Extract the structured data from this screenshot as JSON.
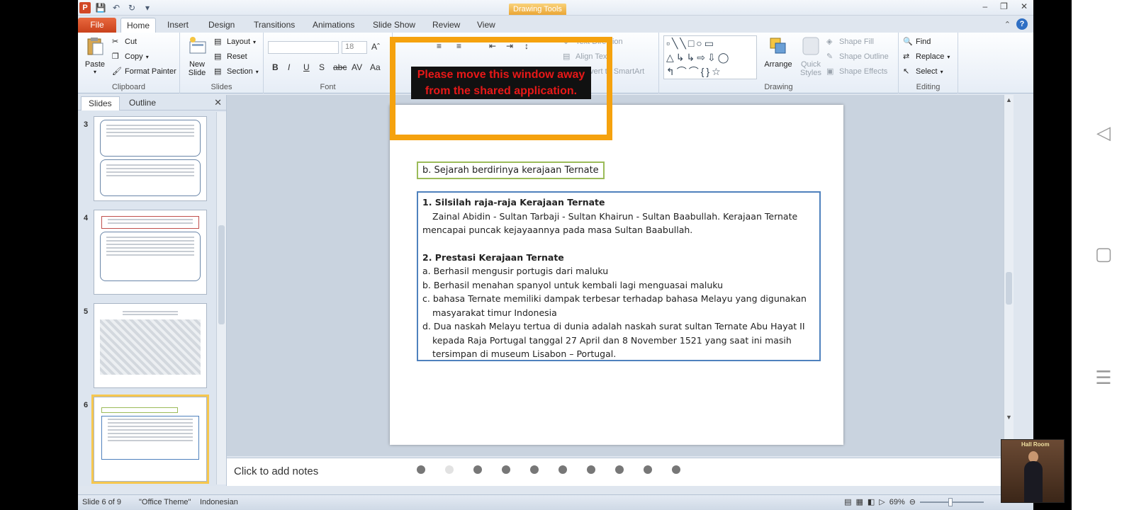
{
  "window": {
    "contextual_tab": "Drawing Tools",
    "controls": [
      "–",
      "❐",
      "✕"
    ]
  },
  "tabs": [
    "File",
    "Home",
    "Insert",
    "Design",
    "Transitions",
    "Animations",
    "Slide Show",
    "Review",
    "View"
  ],
  "ribbon": {
    "clipboard": {
      "group": "Clipboard",
      "paste": "Paste",
      "cut": "Cut",
      "copy": "Copy",
      "format_painter": "Format Painter"
    },
    "slides": {
      "group": "Slides",
      "new_slide": "New Slide",
      "layout": "Layout",
      "reset": "Reset",
      "section": "Section"
    },
    "font": {
      "group": "Font",
      "size": "18"
    },
    "paragraph": {
      "text_direction": "Text Direction",
      "align_text": "Align Text",
      "convert": "Convert to SmartArt"
    },
    "drawing": {
      "group": "Drawing",
      "arrange": "Arrange",
      "quick_styles": "Quick Styles",
      "shape_fill": "Shape Fill",
      "shape_outline": "Shape Outline",
      "shape_effects": "Shape Effects"
    },
    "editing": {
      "group": "Editing",
      "find": "Find",
      "replace": "Replace",
      "select": "Select"
    }
  },
  "share_warning": {
    "line1": "Please move this window away",
    "line2": "from the shared application."
  },
  "left_pane": {
    "tabs": [
      "Slides",
      "Outline"
    ],
    "thumbnails": [
      {
        "num": "3"
      },
      {
        "num": "4"
      },
      {
        "num": "5"
      },
      {
        "num": "6",
        "selected": true
      }
    ]
  },
  "slide": {
    "heading": "b. Sejarah berdirinya kerajaan Ternate",
    "s1_title": "1. Silsilah raja-raja Kerajaan Ternate",
    "s1_line1": "Zainal Abidin - Sultan Tarbaji - Sultan Khairun - Sultan Baabullah.  Kerajaan Ternate",
    "s1_line2": "mencapai puncak kejayaannya pada masa Sultan Baabullah.",
    "s2_title": "2. Prestasi Kerajaan Ternate",
    "items": [
      "a. Berhasil mengusir portugis dari maluku",
      "b. Berhasil menahan spanyol untuk kembali lagi menguasai maluku",
      "c. bahasa Ternate memiliki dampak terbesar terhadap bahasa Melayu yang digunakan masyarakat timur Indonesia",
      "d. Dua naskah Melayu tertua di dunia adalah naskah surat sultan Ternate Abu Hayat II kepada Raja Portugal tanggal 27 April dan 8 November 1521 yang saat ini masih tersimpan di museum Lisabon – Portugal."
    ]
  },
  "notes": {
    "placeholder": "Click to add notes"
  },
  "statusbar": {
    "slide_info": "Slide 6 of 9",
    "theme": "\"Office Theme\"",
    "language": "Indonesian",
    "zoom": "69%"
  },
  "webcam": {
    "sign": "Hall Room"
  }
}
